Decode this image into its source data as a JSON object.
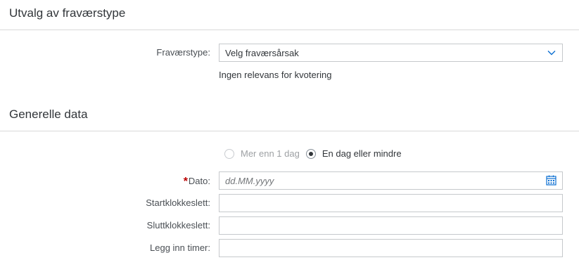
{
  "section1": {
    "title": "Utvalg av fraværstype"
  },
  "absence_type": {
    "label": "Fraværstype:",
    "selected": "Velg fraværsårsak",
    "info": "Ingen relevans for kvotering"
  },
  "section2": {
    "title": "Generelle data"
  },
  "duration": {
    "option_more": "Mer enn 1 dag",
    "option_less": "En dag eller mindre",
    "selected": "En dag eller mindre"
  },
  "date": {
    "required_mark": "*",
    "label": "Dato:",
    "placeholder": "dd.MM.yyyy",
    "value": ""
  },
  "start_time": {
    "label": "Startklokkeslett:",
    "value": ""
  },
  "end_time": {
    "label": "Sluttklokkeslett:",
    "value": ""
  },
  "hours": {
    "label": "Legg inn timer:",
    "value": ""
  },
  "colors": {
    "accent": "#0a6ed1",
    "required": "#bb0000",
    "border": "#c6c9cc",
    "divider": "#d9d9d9"
  }
}
